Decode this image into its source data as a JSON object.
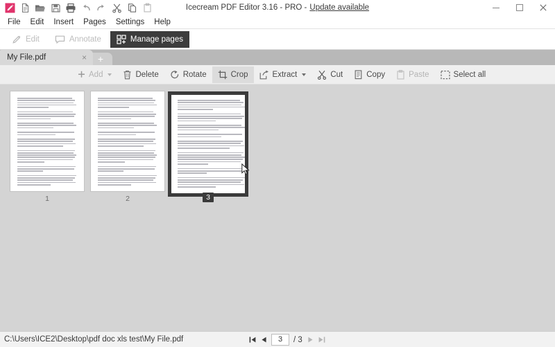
{
  "window": {
    "title_main": "Icecream PDF Editor 3.16 - PRO - ",
    "title_update_link": "Update available",
    "minimize": "minimize-icon",
    "maximize": "maximize-icon",
    "close": "close-icon"
  },
  "quick_access": [
    {
      "name": "edit-pen-icon",
      "label": "Edit",
      "accent": "#E0336B"
    },
    {
      "name": "new-file-icon",
      "label": "New"
    },
    {
      "name": "open-folder-icon",
      "label": "Open"
    },
    {
      "name": "save-icon",
      "label": "Save"
    },
    {
      "name": "print-icon",
      "label": "Print"
    },
    {
      "name": "undo-icon",
      "label": "Undo"
    },
    {
      "name": "redo-icon",
      "label": "Redo"
    },
    {
      "name": "cut-scissors-icon",
      "label": "Cut"
    },
    {
      "name": "copy-icon",
      "label": "Copy"
    },
    {
      "name": "paste-icon",
      "label": "Paste"
    }
  ],
  "menubar": {
    "items": [
      {
        "label": "File"
      },
      {
        "label": "Edit"
      },
      {
        "label": "Insert"
      },
      {
        "label": "Pages"
      },
      {
        "label": "Settings"
      },
      {
        "label": "Help"
      }
    ]
  },
  "modes": [
    {
      "label": "Edit",
      "icon": "pencil-icon",
      "state": "disabled"
    },
    {
      "label": "Annotate",
      "icon": "comment-bubble-icon",
      "state": "disabled"
    },
    {
      "label": "Manage pages",
      "icon": "manage-pages-icon",
      "state": "active"
    }
  ],
  "document_tabs": {
    "tabs": [
      {
        "label": "My File.pdf",
        "close": "×"
      }
    ],
    "new_tab_label": "+"
  },
  "actions": [
    {
      "label": "Add",
      "icon": "plus-icon",
      "dropdown": true,
      "state": "dim"
    },
    {
      "label": "Delete",
      "icon": "trash-icon",
      "dropdown": false,
      "state": "normal"
    },
    {
      "label": "Rotate",
      "icon": "rotate-icon",
      "dropdown": false,
      "state": "normal"
    },
    {
      "label": "Crop",
      "icon": "crop-icon",
      "dropdown": false,
      "state": "hover"
    },
    {
      "label": "Extract",
      "icon": "extract-icon",
      "dropdown": true,
      "state": "normal"
    },
    {
      "label": "Cut",
      "icon": "scissors-icon",
      "dropdown": false,
      "state": "normal"
    },
    {
      "label": "Copy",
      "icon": "copy-pages-icon",
      "dropdown": false,
      "state": "normal"
    },
    {
      "label": "Paste",
      "icon": "clipboard-icon",
      "dropdown": false,
      "state": "dim"
    },
    {
      "label": "Select all",
      "icon": "select-all-icon",
      "dropdown": false,
      "state": "normal"
    }
  ],
  "pages": [
    {
      "number": "1",
      "selected": false
    },
    {
      "number": "2",
      "selected": false
    },
    {
      "number": "3",
      "selected": true
    }
  ],
  "statusbar": {
    "file_path": "C:\\Users\\ICE2\\Desktop\\pdf doc xls test\\My File.pdf",
    "first_label": "first-page",
    "prev_label": "previous-page",
    "current_page": "3",
    "total_pages": "/ 3",
    "next_label": "next-page",
    "last_label": "last-page"
  },
  "colors": {
    "accent_pink": "#E0336B",
    "active_tab_bg": "#3C3C3C",
    "canvas_bg": "#D4D4D4",
    "selection_border": "#3B3B3B"
  }
}
